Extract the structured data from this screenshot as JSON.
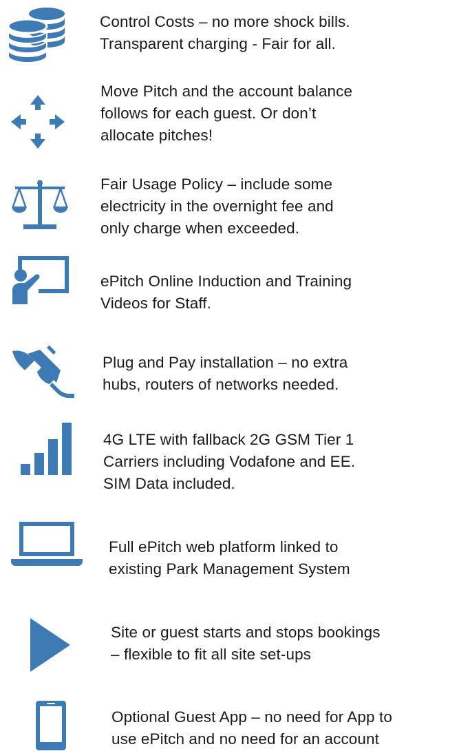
{
  "accent_color": "#3e7bb4",
  "features": [
    {
      "icon": "coins-stack-icon",
      "lines": [
        "Control Costs – no more shock bills.",
        "Transparent charging - Fair for all."
      ]
    },
    {
      "icon": "move-arrows-icon",
      "lines": [
        "Move Pitch and the account balance",
        "follows for each guest. Or don’t",
        "allocate pitches!"
      ]
    },
    {
      "icon": "balance-scale-icon",
      "lines": [
        "Fair Usage Policy – include some",
        "electricity in the overnight fee and",
        "only charge when exceeded."
      ]
    },
    {
      "icon": "presentation-training-icon",
      "lines": [
        "ePitch Online Induction and Training",
        "Videos for Staff."
      ]
    },
    {
      "icon": "plug-socket-icon",
      "lines": [
        "Plug and Pay installation – no extra",
        "hubs, routers of networks needed."
      ]
    },
    {
      "icon": "signal-bars-icon",
      "lines": [
        "4G LTE with fallback 2G GSM Tier 1",
        "Carriers including Vodafone and EE.",
        "SIM Data included."
      ]
    },
    {
      "icon": "laptop-icon",
      "lines": [
        "Full ePitch web platform linked to",
        "existing Park Management System"
      ]
    },
    {
      "icon": "play-triangle-icon",
      "lines": [
        "Site or guest starts and stops bookings",
        "– flexible to fit all site set-ups"
      ]
    },
    {
      "icon": "smartphone-icon",
      "lines": [
        "Optional Guest App – no need for App to",
        "use ePitch and no need for an account"
      ]
    }
  ]
}
